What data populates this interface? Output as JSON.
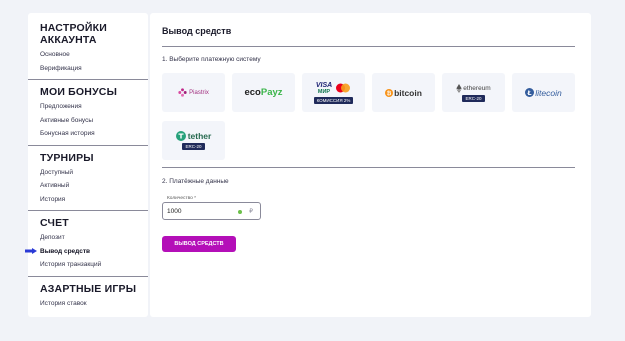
{
  "sidebar": {
    "sections": [
      {
        "title_line1": "НАСТРОЙКИ",
        "title_line2": "АККАУНТА",
        "items": [
          "Основное",
          "Верификация"
        ]
      },
      {
        "title": "МОИ БОНУСЫ",
        "items": [
          "Предложения",
          "Активные бонусы",
          "Бонусная история"
        ]
      },
      {
        "title": "ТУРНИРЫ",
        "items": [
          "Доступный",
          "Активный",
          "История"
        ]
      },
      {
        "title": "СЧЕТ",
        "items": [
          "Депозит",
          "Вывод средств",
          "История транзакций"
        ]
      },
      {
        "title": "АЗАРТНЫЕ ИГРЫ",
        "items": [
          "История ставок"
        ]
      }
    ]
  },
  "main": {
    "title": "Вывод средств",
    "step1": "1. Выберите платежную систему",
    "step2": "2. Платёжные данные",
    "methods": {
      "piastrix": "Piastrix",
      "ecopayz_eco": "eco",
      "ecopayz_payz": "Payz",
      "visa": "VISA",
      "mir": "МИР",
      "card_badge": "КОМИССИЯ 2%",
      "bitcoin": "bitcoin",
      "ethereum": "ethereum",
      "eth_badge": "ERC-20",
      "litecoin": "litecoin",
      "tether": "tether",
      "tether_badge": "ERC-20"
    },
    "amount_label": "Количество *",
    "amount_value": "1000",
    "currency": "₽",
    "submit_label": "Вывод средств"
  },
  "colors": {
    "accent": "#b40fb8",
    "arrow": "#2a3ad6",
    "badge": "#1f2a5a"
  }
}
